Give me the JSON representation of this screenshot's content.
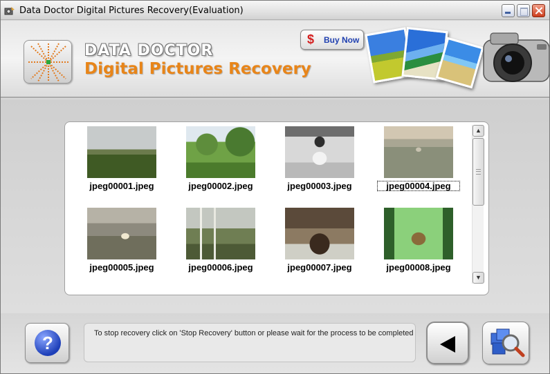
{
  "window": {
    "title": "Data Doctor Digital Pictures Recovery(Evaluation)"
  },
  "header": {
    "brand_line1": "DATA DOCTOR",
    "brand_line2": "Digital Pictures Recovery",
    "buy_now_label": "Buy Now",
    "buy_now_icon": "$"
  },
  "gallery": {
    "items": [
      {
        "label": "jpeg00001.jpeg"
      },
      {
        "label": "jpeg00002.jpeg"
      },
      {
        "label": "jpeg00003.jpeg"
      },
      {
        "label": "jpeg00004.jpeg"
      },
      {
        "label": "jpeg00005.jpeg"
      },
      {
        "label": "jpeg00006.jpeg"
      },
      {
        "label": "jpeg00007.jpeg"
      },
      {
        "label": "jpeg00008.jpeg"
      }
    ],
    "selected_label": "jpeg00004.jpeg"
  },
  "footer": {
    "help_label": "?",
    "status_message": "To stop recovery click on 'Stop Recovery' button or please wait for the process to be completed"
  },
  "colors": {
    "brand_orange": "#e88519",
    "close_red": "#cc3d1c",
    "help_blue": "#1d3fb8"
  }
}
